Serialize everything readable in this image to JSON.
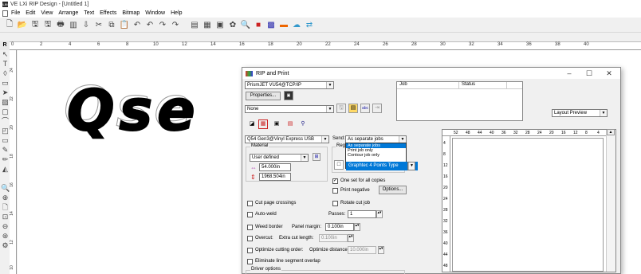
{
  "app": {
    "title": "VE LXi RIP Design - [Untitled 1]",
    "icon_text": "LXi"
  },
  "menu": [
    "File",
    "Edit",
    "View",
    "Arrange",
    "Text",
    "Effects",
    "Bitmap",
    "Window",
    "Help"
  ],
  "toolbar_icons": [
    "new-icon",
    "open-icon",
    "save-icon",
    "save-as-icon",
    "print-icon",
    "rip-icon",
    "import-icon",
    "cut-icon",
    "copy-icon",
    "paste-icon",
    "undo-icon",
    "undo2-icon",
    "redo-icon",
    "redo2-icon",
    "align-icon",
    "arrange-icon",
    "group-icon",
    "color-icon",
    "zoom-icon",
    "palette-icon",
    "image-icon",
    "color-picker-icon",
    "cloud-icon",
    "transfer-icon"
  ],
  "ruler": {
    "corner_text": "R",
    "h_ticks": [
      "0",
      "2",
      "4",
      "6",
      "8",
      "10",
      "12",
      "14",
      "16",
      "18",
      "20",
      "22",
      "24",
      "26",
      "28",
      "30",
      "32",
      "34",
      "36",
      "38",
      "40"
    ],
    "v_ticks": [
      "24",
      "22",
      "20",
      "18",
      "16",
      "14",
      "12",
      "10"
    ]
  },
  "canvas": {
    "text": "Qse"
  },
  "dialog": {
    "title": "RIP and Print",
    "printer_value": "PrismJET VU54@TCP/IP",
    "properties_label": "Properties...",
    "preset_value": "None",
    "job_columns": [
      "Job",
      "Status"
    ],
    "layout_preview_value": "Layout Preview",
    "cutter_value": "Q54 Gen3@Vinyl Express USB",
    "send_label": "Send:",
    "send_value": "As separate jobs",
    "send_options": [
      "As separate jobs",
      "Print job only",
      "Contour job only"
    ],
    "registration_label": "Registra",
    "registration_value": "Graphtec 4 Points Type",
    "material_label": "Material",
    "material_value": "User defined",
    "width_value": "54.000in",
    "length_value": "1968.504in",
    "one_set_label": "One set for all copies",
    "one_set_checked": true,
    "print_negative_label": "Print negative",
    "options_label": "Options...",
    "cut_page_crossings_label": "Cut page crossings",
    "rotate_cut_job_label": "Rotate cut job",
    "auto_weld_label": "Auto-weld",
    "passes_label": "Passes:",
    "passes_value": "1",
    "weed_border_label": "Weed border",
    "panel_margin_label": "Panel margin:",
    "panel_margin_value": "0.100in",
    "overcut_label": "Overcut:",
    "extra_cut_length_label": "Extra cut length:",
    "extra_cut_length_value": "0.100in",
    "optimize_order_label": "Optimize cutting order:",
    "optimize_distance_label": "Optimize distance:",
    "optimize_distance_value": "10.000in",
    "eliminate_overlap_label": "Eliminate line segment overlap",
    "driver_options_label": "Driver options",
    "preview_h_ticks": [
      "52",
      "48",
      "44",
      "40",
      "36",
      "32",
      "28",
      "24",
      "20",
      "16",
      "12",
      "8",
      "4"
    ],
    "preview_v_ticks": [
      "4",
      "8",
      "12",
      "16",
      "20",
      "24",
      "28",
      "32",
      "36",
      "40",
      "44",
      "48"
    ]
  }
}
